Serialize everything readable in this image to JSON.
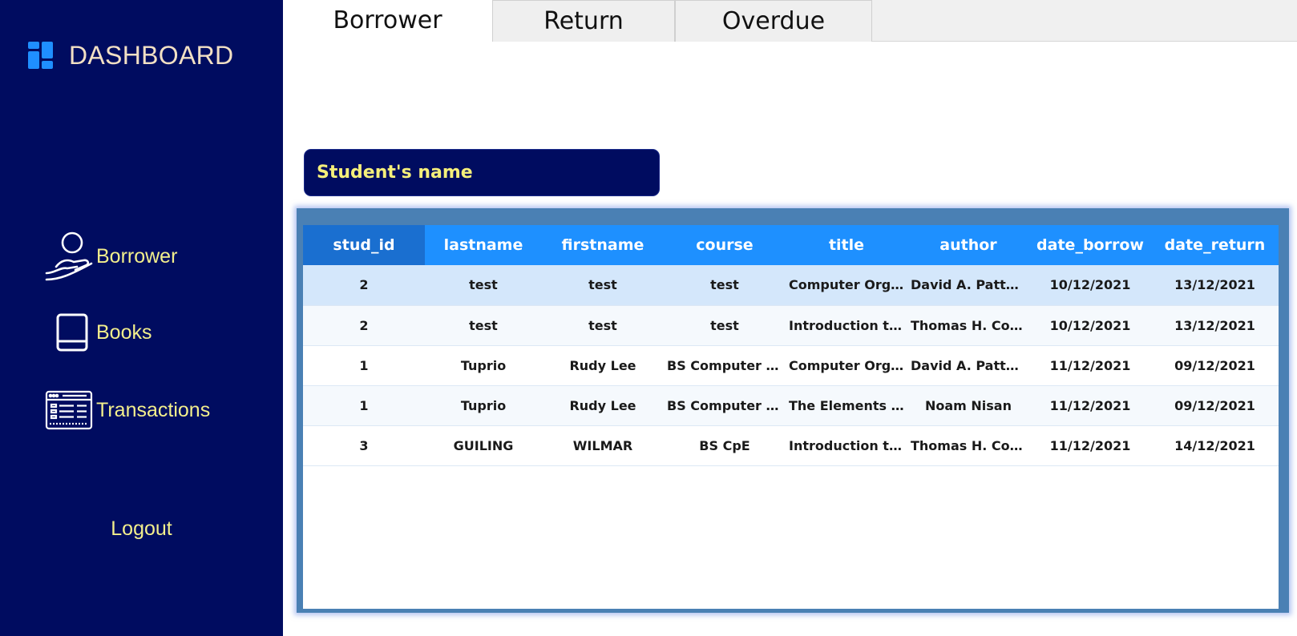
{
  "sidebar": {
    "brand": "DASHBOARD",
    "items": [
      {
        "label": "Borrower",
        "icon": "hand-person-icon"
      },
      {
        "label": "Books",
        "icon": "book-icon"
      },
      {
        "label": "Transactions",
        "icon": "window-list-icon"
      }
    ],
    "logout": "Logout"
  },
  "tabs": [
    {
      "label": "Borrower",
      "active": true
    },
    {
      "label": "Return",
      "active": false
    },
    {
      "label": "Overdue",
      "active": false
    }
  ],
  "student_field": {
    "label": "Student's name"
  },
  "table": {
    "columns": [
      "stud_id",
      "lastname",
      "firstname",
      "course",
      "title",
      "author",
      "date_borrow",
      "date_return"
    ],
    "rows": [
      [
        "2",
        "test",
        "test",
        "test",
        "Computer Organ...",
        "David A. Patterson",
        "10/12/2021",
        "13/12/2021"
      ],
      [
        "2",
        "test",
        "test",
        "test",
        "Introduction to ...",
        "Thomas H. Corm...",
        "10/12/2021",
        "13/12/2021"
      ],
      [
        "1",
        "Tuprio",
        "Rudy Lee",
        "BS Computer En...",
        "Computer Organ...",
        "David A. Patterson",
        "11/12/2021",
        "09/12/2021"
      ],
      [
        "1",
        "Tuprio",
        "Rudy Lee",
        "BS Computer En...",
        "The Elements of ...",
        "Noam Nisan",
        "11/12/2021",
        "09/12/2021"
      ],
      [
        "3",
        "GUILING",
        "WILMAR",
        "BS CpE",
        "Introduction to ...",
        "Thomas H. Corm...",
        "11/12/2021",
        "14/12/2021"
      ]
    ]
  },
  "colors": {
    "sidebar_bg": "#000c60",
    "accent_yellow": "#f3ef8c",
    "brand_text": "#f2e0c4",
    "header_blue": "#1e90ff",
    "selected_row": "#d4e7fb"
  }
}
